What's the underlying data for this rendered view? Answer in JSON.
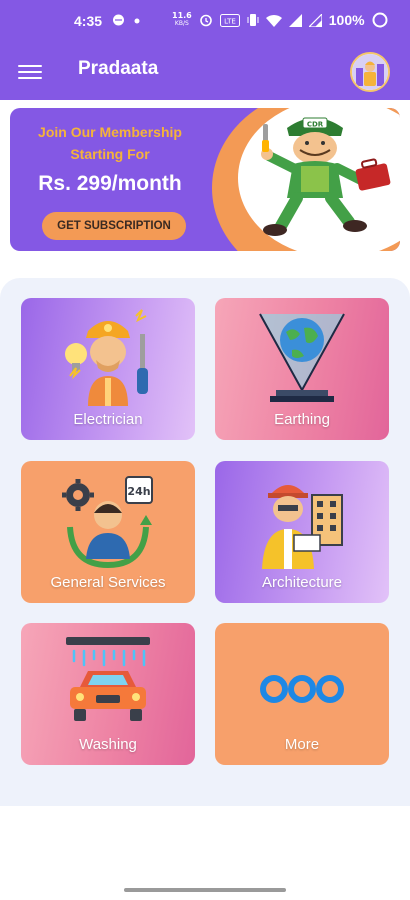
{
  "status_bar": {
    "time": "4:35",
    "speed": "11.6",
    "speed_unit": "KB/S",
    "battery_text": "100%",
    "icons": [
      "chat-icon",
      "dot-icon",
      "alarm-icon",
      "volte-icon",
      "vibrate-icon",
      "wifi-icon",
      "signal-icon",
      "signal-2-icon",
      "battery-icon"
    ]
  },
  "app_bar": {
    "title": "Pradaata",
    "menu_icon": "hamburger-menu-icon",
    "avatar_icon": "profile-avatar"
  },
  "banner": {
    "line1": "Join Our Membership",
    "line2": "Starting For",
    "price": "Rs. 299/month",
    "cta": "GET SUBSCRIPTION",
    "badge_text": "CDR",
    "colors": {
      "background": "#8458e4",
      "accent": "#f39a55",
      "headline": "#f5b33a"
    }
  },
  "services": [
    {
      "label": "Electrician",
      "icon": "electrician-icon"
    },
    {
      "label": "Earthing",
      "icon": "earthing-globe-icon"
    },
    {
      "label": "General Services",
      "icon": "general-services-24h-icon"
    },
    {
      "label": "Architecture",
      "icon": "architect-icon"
    },
    {
      "label": "Washing",
      "icon": "car-wash-icon"
    },
    {
      "label": "More",
      "icon": "more-dots-icon"
    }
  ],
  "theme": {
    "primary": "#8458e4",
    "panel": "#eef2fb",
    "more_dot": "#1e88e5"
  }
}
